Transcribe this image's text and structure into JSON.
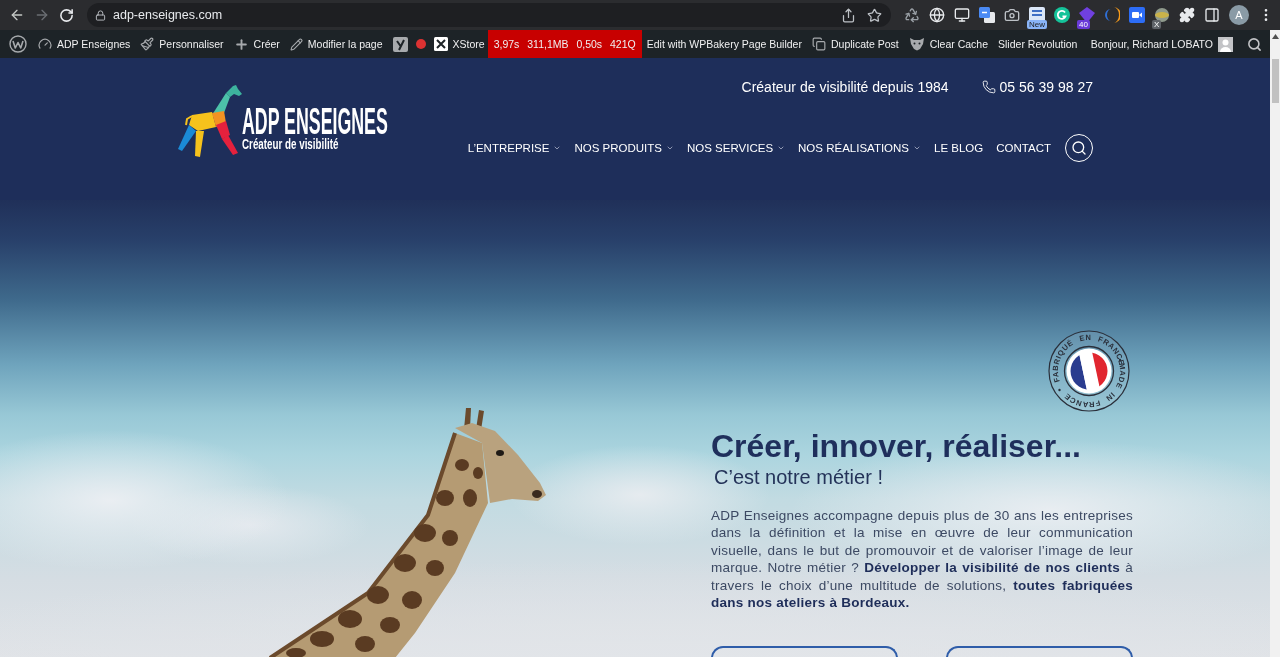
{
  "browser": {
    "address": "adp-enseignes.com",
    "extensions": [
      {
        "kind": "recycle"
      },
      {
        "kind": "globe"
      },
      {
        "kind": "monitor"
      },
      {
        "kind": "translate"
      },
      {
        "kind": "camera"
      },
      {
        "kind": "tile",
        "badge": "New"
      },
      {
        "kind": "ring"
      },
      {
        "kind": "diamond",
        "badge": "40"
      },
      {
        "kind": "crescent"
      },
      {
        "kind": "video"
      },
      {
        "kind": "sphere",
        "badge": "X"
      },
      {
        "kind": "puzzle"
      }
    ],
    "profile_initial": "A"
  },
  "admin_bar": {
    "items": [
      {
        "kind": "logo"
      },
      {
        "kind": "site",
        "label": "ADP Enseignes"
      },
      {
        "kind": "customize",
        "label": "Personnaliser"
      },
      {
        "kind": "new",
        "label": "Créer"
      },
      {
        "kind": "edit",
        "label": "Modifier la page"
      },
      {
        "kind": "seo"
      },
      {
        "kind": "xstore",
        "label": "XStore"
      },
      {
        "kind": "metrics",
        "label": "3,97s 311,1MB 0,50s 421Q"
      },
      {
        "kind": "builder",
        "label": "Edit with WPBakery Page Builder"
      },
      {
        "kind": "duplicate",
        "label": "Duplicate Post"
      },
      {
        "kind": "cache",
        "label": "Clear Cache"
      },
      {
        "kind": "slider",
        "label": "Slider Revolution"
      }
    ],
    "greeting": "Bonjour, Richard LOBATO"
  },
  "header": {
    "logo": {
      "name": "ADP ENSEIGNES",
      "slogan": "Créateur de visibilité"
    },
    "tagline": "Créateur de visibilité depuis 1984",
    "phone": "05 56 39 98 27",
    "nav": [
      {
        "label": "L’ENTREPRISE",
        "dropdown": true
      },
      {
        "label": "NOS PRODUITS",
        "dropdown": true
      },
      {
        "label": "NOS SERVICES",
        "dropdown": true
      },
      {
        "label": "NOS RÉALISATIONS",
        "dropdown": true
      },
      {
        "label": "LE BLOG",
        "dropdown": false
      },
      {
        "label": "CONTACT",
        "dropdown": false
      }
    ]
  },
  "hero": {
    "badge": {
      "top": "FABRIQUÉ EN FRANCE",
      "bottom": "MADE IN FRANCE"
    },
    "title": "Créer, innover, réaliser...",
    "subtitle": "C’est notre métier !",
    "intro": "ADP Enseignes accompagne depuis plus de 30 ans les entreprises dans la définition et la mise en œuvre de leur communication visuelle, dans le but de promouvoir et de valoriser l’image de leur marque. Notre métier ? **Développer la visibilité de nos clients** à travers le choix d’une multitude de solutions, **toutes fabriquées dans nos ateliers à Bordeaux.**",
    "buttons": [
      {
        "kind": "outline"
      },
      {
        "kind": "outline"
      }
    ]
  }
}
